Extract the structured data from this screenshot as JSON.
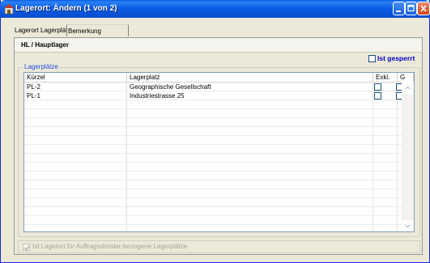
{
  "window": {
    "title": "Lagerort: Ändern (1 von 2)",
    "icon": "warehouse-icon",
    "controls": [
      "minimize-icon",
      "maximize-icon",
      "close-icon"
    ]
  },
  "tabs": [
    {
      "label": "Lagerort Lagerplätze",
      "selected": true
    },
    {
      "label": "Bemerkung",
      "selected": false
    }
  ],
  "header": {
    "title": "HL / Hauptlager"
  },
  "locked": {
    "label": "Ist gesperrt",
    "checked": false,
    "color": "#0000cc"
  },
  "group": {
    "label": "Lagerplätze",
    "color": "#1f4fd9"
  },
  "grid": {
    "columns": [
      "Kürzel",
      "Lagerplatz",
      "Exkl.",
      "G"
    ],
    "rows": [
      {
        "code": "PL-2",
        "name": "Geographische Gesellschaft",
        "exkl": false,
        "g": false
      },
      {
        "code": "PL-1",
        "name": "Industriestrasse 25",
        "exkl": false,
        "g": false
      }
    ]
  },
  "assignment": {
    "label": "Ist Lagerort für Auftragsdossier-bezogene Lagerplätze",
    "checked": true,
    "disabled": true
  }
}
